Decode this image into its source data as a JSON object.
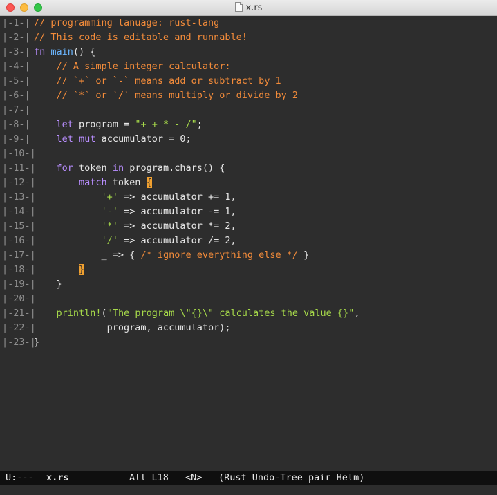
{
  "window": {
    "title": "x.rs",
    "colors": {
      "comment": "#f28b3a",
      "keyword": "#b98eff",
      "function": "#6bb6ff",
      "string": "#a6d94a",
      "cursor": "#f0a030",
      "background": "#2d2d2d"
    }
  },
  "lines": [
    {
      "num": "|-1-|",
      "tokens": [
        {
          "t": "// programming lanuage: rust-lang",
          "c": "c"
        }
      ]
    },
    {
      "num": "|-2-|",
      "tokens": [
        {
          "t": "// This code is editable and runnable!",
          "c": "c"
        }
      ]
    },
    {
      "num": "|-3-|",
      "tokens": [
        {
          "t": "fn",
          "c": "k"
        },
        {
          "t": " ",
          "c": "p"
        },
        {
          "t": "main",
          "c": "fnname"
        },
        {
          "t": "() {",
          "c": "p"
        }
      ]
    },
    {
      "num": "|-4-|",
      "tokens": [
        {
          "t": "    ",
          "c": "p"
        },
        {
          "t": "// A simple integer calculator:",
          "c": "c"
        }
      ]
    },
    {
      "num": "|-5-|",
      "tokens": [
        {
          "t": "    ",
          "c": "p"
        },
        {
          "t": "// `+` or `-` means add or subtract by 1",
          "c": "c"
        }
      ]
    },
    {
      "num": "|-6-|",
      "tokens": [
        {
          "t": "    ",
          "c": "p"
        },
        {
          "t": "// `*` or `/` means multiply or divide by 2",
          "c": "c"
        }
      ]
    },
    {
      "num": "|-7-|",
      "tokens": []
    },
    {
      "num": "|-8-|",
      "tokens": [
        {
          "t": "    ",
          "c": "p"
        },
        {
          "t": "let",
          "c": "k"
        },
        {
          "t": " program = ",
          "c": "p"
        },
        {
          "t": "\"+ + * - /\"",
          "c": "s"
        },
        {
          "t": ";",
          "c": "p"
        }
      ]
    },
    {
      "num": "|-9-|",
      "tokens": [
        {
          "t": "    ",
          "c": "p"
        },
        {
          "t": "let",
          "c": "k"
        },
        {
          "t": " ",
          "c": "p"
        },
        {
          "t": "mut",
          "c": "k"
        },
        {
          "t": " accumulator = 0;",
          "c": "p"
        }
      ]
    },
    {
      "num": "|-10-|",
      "tokens": []
    },
    {
      "num": "|-11-|",
      "tokens": [
        {
          "t": "    ",
          "c": "p"
        },
        {
          "t": "for",
          "c": "k"
        },
        {
          "t": " token ",
          "c": "p"
        },
        {
          "t": "in",
          "c": "k"
        },
        {
          "t": " program.chars() {",
          "c": "p"
        }
      ]
    },
    {
      "num": "|-12-|",
      "tokens": [
        {
          "t": "        ",
          "c": "p"
        },
        {
          "t": "match",
          "c": "k"
        },
        {
          "t": " token ",
          "c": "p"
        },
        {
          "t": "{",
          "c": "match"
        }
      ]
    },
    {
      "num": "|-13-|",
      "tokens": [
        {
          "t": "            ",
          "c": "p"
        },
        {
          "t": "'+'",
          "c": "s"
        },
        {
          "t": " => accumulator += 1,",
          "c": "p"
        }
      ]
    },
    {
      "num": "|-14-|",
      "tokens": [
        {
          "t": "            ",
          "c": "p"
        },
        {
          "t": "'-'",
          "c": "s"
        },
        {
          "t": " => accumulator -= 1,",
          "c": "p"
        }
      ]
    },
    {
      "num": "|-15-|",
      "tokens": [
        {
          "t": "            ",
          "c": "p"
        },
        {
          "t": "'*'",
          "c": "s"
        },
        {
          "t": " => accumulator *= 2,",
          "c": "p"
        }
      ]
    },
    {
      "num": "|-16-|",
      "tokens": [
        {
          "t": "            ",
          "c": "p"
        },
        {
          "t": "'/'",
          "c": "s"
        },
        {
          "t": " => accumulator /= 2,",
          "c": "p"
        }
      ]
    },
    {
      "num": "|-17-|",
      "tokens": [
        {
          "t": "            _ => { ",
          "c": "p"
        },
        {
          "t": "/* ignore everything else */",
          "c": "c"
        },
        {
          "t": " }",
          "c": "p"
        }
      ]
    },
    {
      "num": "|-18-|",
      "tokens": [
        {
          "t": "        ",
          "c": "p"
        },
        {
          "t": "}",
          "c": "cursor"
        }
      ]
    },
    {
      "num": "|-19-|",
      "tokens": [
        {
          "t": "    }",
          "c": "p"
        }
      ]
    },
    {
      "num": "|-20-|",
      "tokens": []
    },
    {
      "num": "|-21-|",
      "tokens": [
        {
          "t": "    ",
          "c": "p"
        },
        {
          "t": "println!",
          "c": "s"
        },
        {
          "t": "(",
          "c": "p"
        },
        {
          "t": "\"The program \\\"{}\\\" calculates the value {}\"",
          "c": "s"
        },
        {
          "t": ",",
          "c": "p"
        }
      ]
    },
    {
      "num": "|-22-|",
      "tokens": [
        {
          "t": "             program, accumulator);",
          "c": "p"
        }
      ]
    },
    {
      "num": "|-23-|",
      "tokens": [
        {
          "t": "}",
          "c": "p"
        }
      ]
    }
  ],
  "modeline": {
    "state": "U:---",
    "filename": "x.rs",
    "position": "All L18",
    "evil_state": "<N>",
    "modes": "(Rust Undo-Tree pair Helm)"
  }
}
